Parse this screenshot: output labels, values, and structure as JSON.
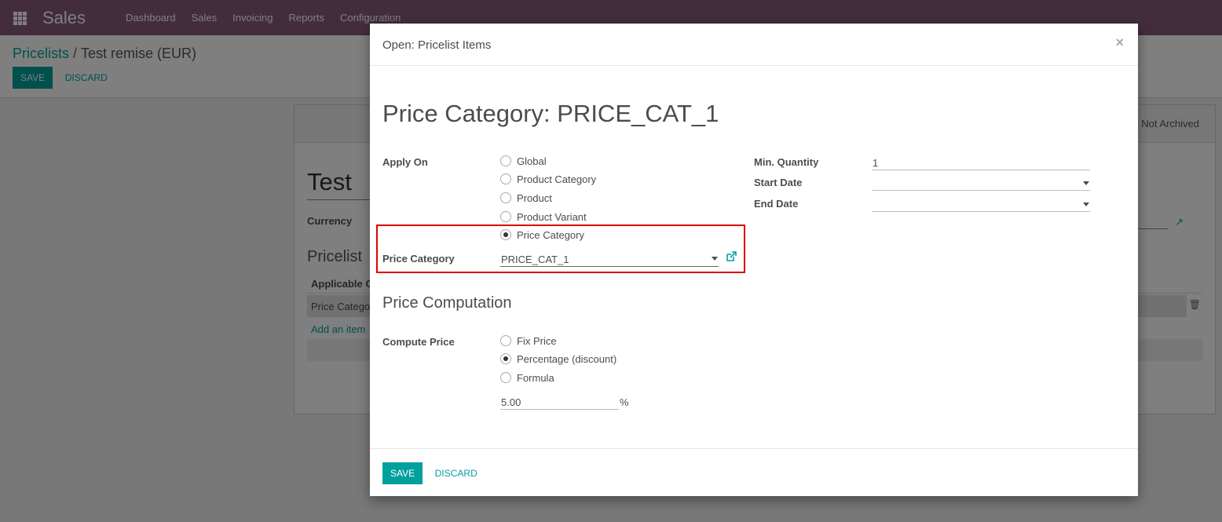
{
  "navbar": {
    "brand": "Sales",
    "menu": [
      "Dashboard",
      "Sales",
      "Invoicing",
      "Reports",
      "Configuration"
    ]
  },
  "control_panel": {
    "breadcrumb_parent": "Pricelists",
    "breadcrumb_separator": "/",
    "breadcrumb_current": "Test remise (EUR)",
    "save_label": "SAVE",
    "discard_label": "DISCARD"
  },
  "background_form": {
    "status": "Not Archived",
    "name": "Test",
    "currency_label": "Currency",
    "section": "Pricelist",
    "column_header": "Applicable On",
    "row_value": "Price Category",
    "add_item": "Add an item"
  },
  "modal": {
    "title": "Open: Pricelist Items",
    "close_glyph": "×",
    "heading": "Price Category: PRICE_CAT_1",
    "apply_on_label": "Apply On",
    "apply_on_options": [
      {
        "label": "Global",
        "checked": false
      },
      {
        "label": "Product Category",
        "checked": false
      },
      {
        "label": "Product",
        "checked": false
      },
      {
        "label": "Product Variant",
        "checked": false
      },
      {
        "label": "Price Category",
        "checked": true
      }
    ],
    "price_category_label": "Price Category",
    "price_category_value": "PRICE_CAT_1",
    "min_qty_label": "Min. Quantity",
    "min_qty_value": "1",
    "start_date_label": "Start Date",
    "start_date_value": "",
    "end_date_label": "End Date",
    "end_date_value": "",
    "computation_title": "Price Computation",
    "compute_price_label": "Compute Price",
    "compute_options": [
      {
        "label": "Fix Price",
        "checked": false
      },
      {
        "label": "Percentage (discount)",
        "checked": true
      },
      {
        "label": "Formula",
        "checked": false
      }
    ],
    "percent_value": "5.00",
    "percent_unit": "%",
    "save_label": "SAVE",
    "discard_label": "DISCARD"
  },
  "colors": {
    "navbar": "#875a7b",
    "primary": "#00a09d",
    "highlight": "#e00000"
  },
  "icons": [
    "apps-grid-icon",
    "close-icon",
    "external-link-icon",
    "trash-icon",
    "dropdown-caret-icon"
  ]
}
